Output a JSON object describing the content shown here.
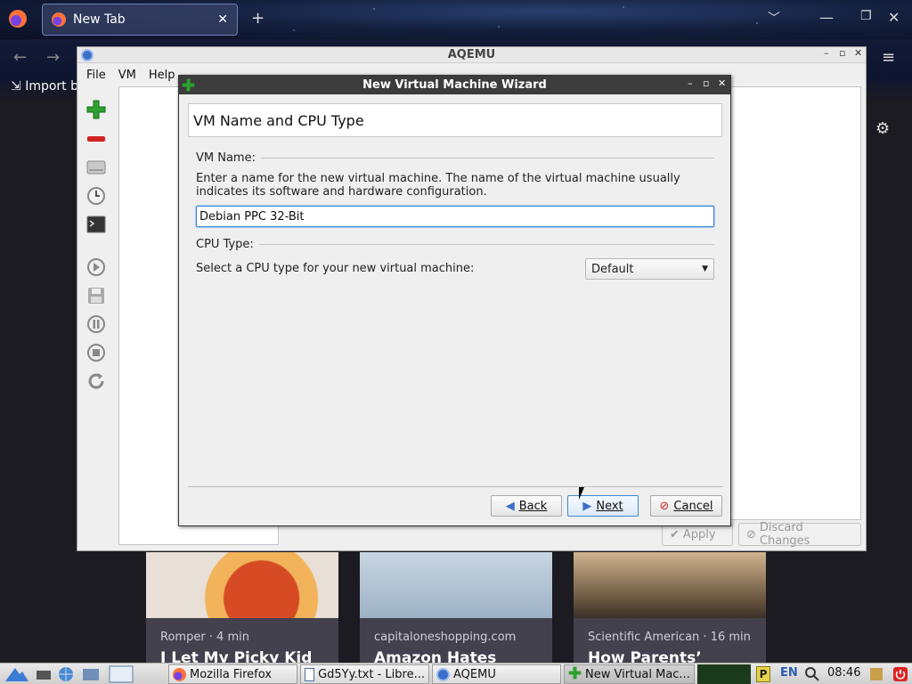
{
  "browser": {
    "tab_title": "New Tab",
    "tab_close": "✕",
    "new_tab": "+",
    "import_label": "Import b",
    "cards": [
      {
        "source": "Romper · 4 min",
        "title": "I Let My Picky Kid"
      },
      {
        "source": "capitaloneshopping.com",
        "title": "Amazon Hates"
      },
      {
        "source": "Scientific American · 16 min",
        "title": "How Parents’"
      }
    ]
  },
  "aqemu": {
    "title": "AQEMU",
    "menu": [
      "File",
      "VM",
      "Help"
    ],
    "apply_label": "Apply",
    "discard_label": "Discard Changes"
  },
  "wizard": {
    "title": "New Virtual Machine Wizard",
    "header": "VM Name and CPU Type",
    "vm_name_group": "VM Name:",
    "vm_name_description": "Enter a name for the new virtual machine. The name of the virtual machine usually indicates its software and hardware configuration.",
    "vm_name_value": "Debian PPC 32-Bit",
    "cpu_group": "CPU Type:",
    "cpu_prompt": "Select a CPU type for your new virtual machine:",
    "cpu_selected": "Default",
    "back_label": "Back",
    "next_label": "Next",
    "cancel_label": "Cancel"
  },
  "taskbar": {
    "tasks": [
      "Mozilla Firefox",
      "Gd5Yy.txt - Libre...",
      "AQEMU",
      "New Virtual Mac..."
    ],
    "tray_p": "P",
    "lang": "EN",
    "clock": "08:46"
  },
  "colors": {
    "accent": "#3b87d4",
    "titlebar_dark": "#3c3c3c",
    "add_green": "#2ea02e",
    "remove_red": "#d22020"
  }
}
